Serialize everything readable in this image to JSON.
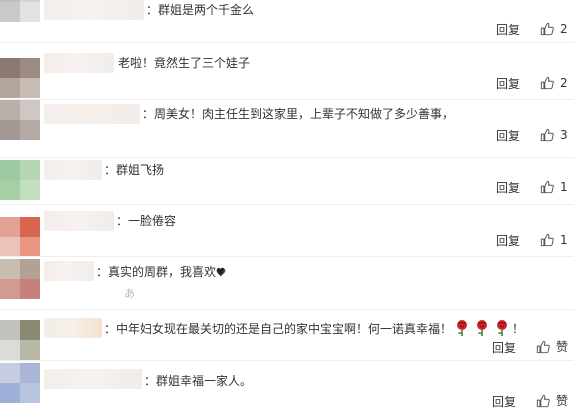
{
  "colors": {
    "accent": "#333333",
    "rose": "#c8242a",
    "divider": "#eeeeee"
  },
  "reply_label": "回复",
  "praise_label": "赞",
  "comments": [
    {
      "text": "：群姐是两个千金么",
      "likes": "2"
    },
    {
      "text": "老啦！竟然生了三个娃子",
      "likes": "2"
    },
    {
      "text": "：周美女！肉主任生到这家里，上辈子不知做了多少善事，",
      "likes": "3"
    },
    {
      "text": "：群姐飞扬",
      "likes": "1"
    },
    {
      "text": "：一脸倦容",
      "likes": "1"
    },
    {
      "text": "：真实的周群，我喜欢",
      "likes": ""
    },
    {
      "text_before": "：中年妇女现在最关切的还是自己的家中宝宝啊！何一诺真幸福！",
      "text_after": "！",
      "likes": "赞"
    },
    {
      "text": "：群姐幸福一家人。",
      "likes": "赞"
    }
  ],
  "icons": {
    "thumb": "thumbs-up-icon",
    "rose": "rose-emoji",
    "heart": "heart-emoji"
  }
}
